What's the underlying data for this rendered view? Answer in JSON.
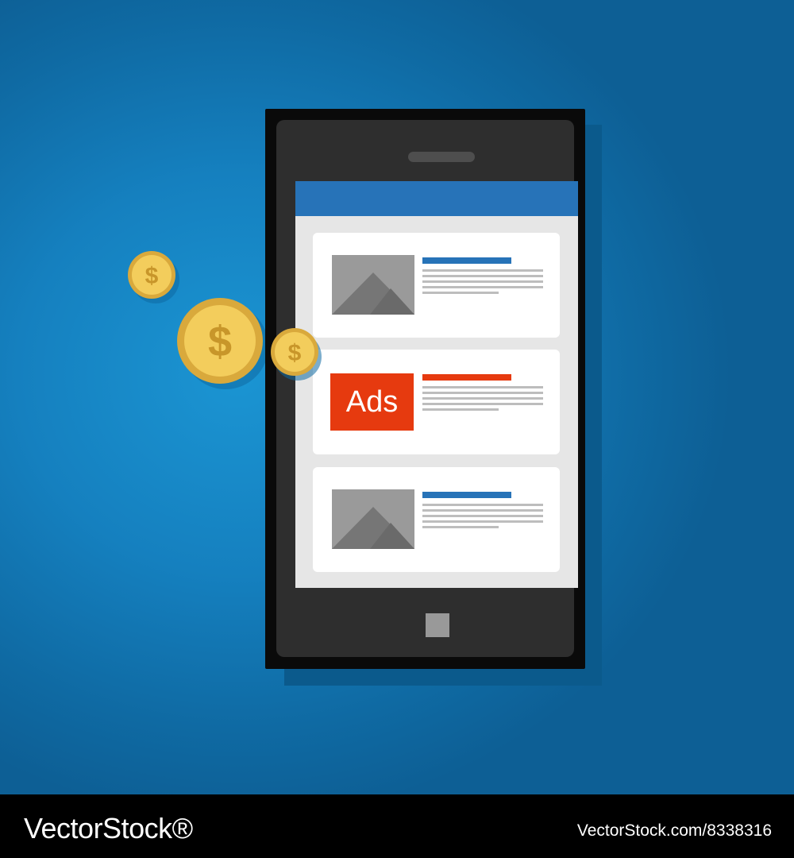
{
  "colors": {
    "background": "#1580bf",
    "header_bar": "#2773b8",
    "ad_accent": "#e63a0f",
    "coin": "#f2c94c",
    "coin_symbol": "#c8962a"
  },
  "phone": {
    "cards": [
      {
        "type": "image-article",
        "title_color": "#2773b8"
      },
      {
        "type": "ad",
        "label": "Ads",
        "title_color": "#e63a0f"
      },
      {
        "type": "image-article",
        "title_color": "#2773b8"
      }
    ]
  },
  "coins": [
    {
      "symbol": "$"
    },
    {
      "symbol": "$"
    },
    {
      "symbol": "$"
    }
  ],
  "footer": {
    "brand": "VectorStock®",
    "image_id": "VectorStock.com/8338316"
  }
}
